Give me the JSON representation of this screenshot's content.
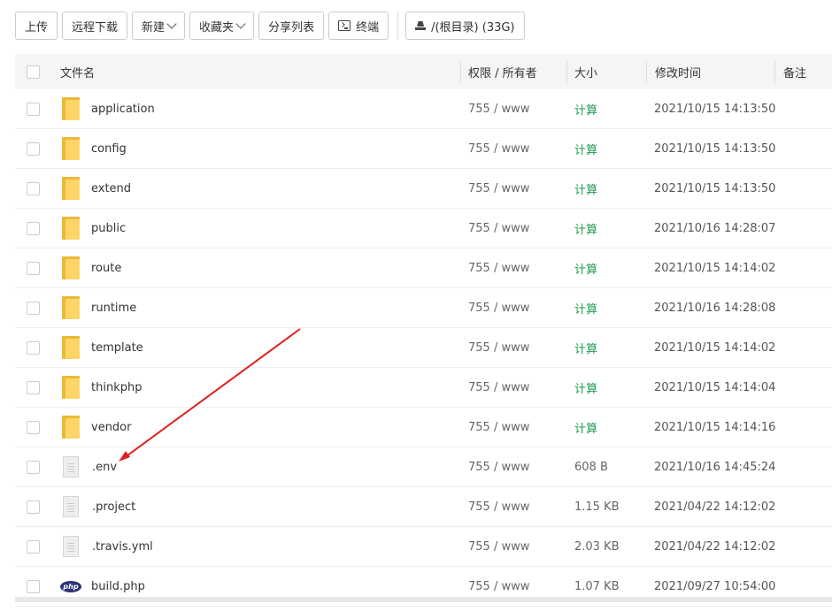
{
  "toolbar": {
    "upload": "上传",
    "remote_download": "远程下载",
    "new": "新建",
    "favorites": "收藏夹",
    "share_list": "分享列表",
    "terminal": "终端",
    "path": "/(根目录) (33G)"
  },
  "table": {
    "headers": {
      "name": "文件名",
      "perm": "权限 / 所有者",
      "size": "大小",
      "mtime": "修改时间",
      "note": "备注"
    },
    "rows": [
      {
        "name": "application",
        "type": "folder",
        "perm": "755 / www",
        "size": "计算",
        "mtime": "2021/10/15 14:13:50"
      },
      {
        "name": "config",
        "type": "folder",
        "perm": "755 / www",
        "size": "计算",
        "mtime": "2021/10/15 14:13:50"
      },
      {
        "name": "extend",
        "type": "folder",
        "perm": "755 / www",
        "size": "计算",
        "mtime": "2021/10/15 14:13:50"
      },
      {
        "name": "public",
        "type": "folder",
        "perm": "755 / www",
        "size": "计算",
        "mtime": "2021/10/16 14:28:07"
      },
      {
        "name": "route",
        "type": "folder",
        "perm": "755 / www",
        "size": "计算",
        "mtime": "2021/10/15 14:14:02"
      },
      {
        "name": "runtime",
        "type": "folder",
        "perm": "755 / www",
        "size": "计算",
        "mtime": "2021/10/16 14:28:08"
      },
      {
        "name": "template",
        "type": "folder",
        "perm": "755 / www",
        "size": "计算",
        "mtime": "2021/10/15 14:14:02"
      },
      {
        "name": "thinkphp",
        "type": "folder",
        "perm": "755 / www",
        "size": "计算",
        "mtime": "2021/10/15 14:14:04"
      },
      {
        "name": "vendor",
        "type": "folder",
        "perm": "755 / www",
        "size": "计算",
        "mtime": "2021/10/15 14:14:16"
      },
      {
        "name": ".env",
        "type": "file",
        "perm": "755 / www",
        "size": "608 B",
        "mtime": "2021/10/16 14:45:24"
      },
      {
        "name": ".project",
        "type": "file",
        "perm": "755 / www",
        "size": "1.15 KB",
        "mtime": "2021/04/22 14:12:02"
      },
      {
        "name": ".travis.yml",
        "type": "file",
        "perm": "755 / www",
        "size": "2.03 KB",
        "mtime": "2021/04/22 14:12:02"
      },
      {
        "name": "build.php",
        "type": "php",
        "icon_text": "php",
        "perm": "755 / www",
        "size": "1.07 KB",
        "mtime": "2021/09/27 10:54:00"
      }
    ]
  },
  "colors": {
    "calc": "#1e9b4e",
    "folder": "#fdd566",
    "arrow": "#e02020",
    "php_icon": "#2b3577"
  }
}
